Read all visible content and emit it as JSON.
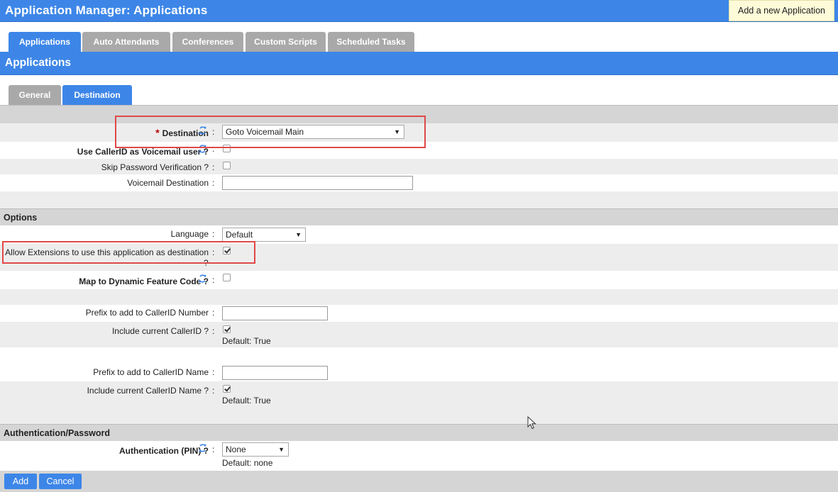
{
  "header": {
    "app_title": "Application Manager:  Applications",
    "add_new_label": "Add a new Application"
  },
  "main_tabs": [
    {
      "label": "Applications",
      "active": true
    },
    {
      "label": "Auto Attendants",
      "active": false
    },
    {
      "label": "Conferences",
      "active": false
    },
    {
      "label": "Custom Scripts",
      "active": false
    },
    {
      "label": "Scheduled Tasks",
      "active": false
    }
  ],
  "section": {
    "title": "Applications"
  },
  "sub_tabs": [
    {
      "label": "General",
      "active": false
    },
    {
      "label": "Destination",
      "active": true
    }
  ],
  "destination_group": {
    "destination_label": "Destination",
    "required_mark": "*",
    "destination_value": "Goto Voicemail Main",
    "use_callerid_label": "Use CallerID as Voicemail user ?",
    "use_callerid_checked": false,
    "skip_password_label": "Skip Password Verification ?",
    "skip_password_checked": false,
    "voicemail_destination_label": "Voicemail Destination",
    "voicemail_destination_value": ""
  },
  "options_group": {
    "title": "Options",
    "language_label": "Language",
    "language_value": "Default",
    "allow_extensions_label": "Allow Extensions to use this application as destination",
    "allow_extensions_q": "?",
    "allow_extensions_checked": true,
    "map_dynamic_label": "Map to Dynamic Feature Code ?",
    "map_dynamic_checked": false,
    "prefix_number_label": "Prefix to add to CallerID Number",
    "prefix_number_value": "",
    "include_callerid_label": "Include current CallerID ?",
    "include_callerid_checked": true,
    "include_callerid_default": "Default: True",
    "prefix_name_label": "Prefix to add to CallerID Name",
    "prefix_name_value": "",
    "include_callerid_name_label": "Include current CallerID Name ?",
    "include_callerid_name_checked": true,
    "include_callerid_name_default": "Default: True"
  },
  "auth_group": {
    "title": "Authentication/Password",
    "auth_label": "Authentication (PIN) ?",
    "auth_value": "None",
    "auth_default": "Default: none"
  },
  "footer": {
    "add_label": "Add",
    "cancel_label": "Cancel"
  },
  "colors": {
    "accent": "#3d86e8",
    "highlight_border": "#e04848",
    "tab_inactive": "#a9a9a9",
    "tooltip_bg": "#fdfbd8",
    "required": "#b40000"
  },
  "icons": {
    "sync": "refresh-icon",
    "dropdown": "chevron-down-icon",
    "cursor": "mouse-pointer-icon"
  },
  "colon": ":"
}
